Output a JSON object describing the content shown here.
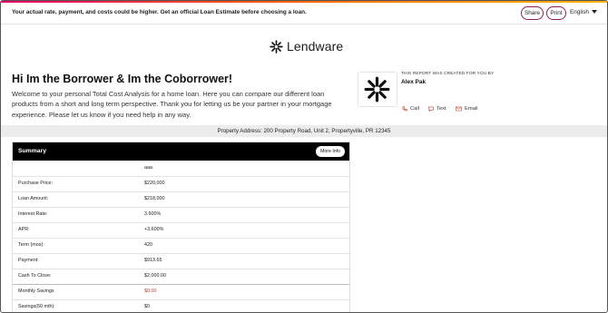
{
  "top_bar": {
    "notice": "Your actual rate, payment, and costs could be higher. Get an official Loan Estimate before choosing a loan.",
    "share_label": "Share",
    "print_label": "Print",
    "language": "English"
  },
  "brand": {
    "name": "Lendware"
  },
  "greeting": {
    "title": "Hi Im the Borrower & Im the Coborrower!",
    "body": "Welcome to your personal Total Cost Analysis for a home loan. Here you can compare our different loan products from a short and long term perspective. Thank you for letting us be your partner in your mortgage experience. Please let us know if you need help in any way."
  },
  "agent": {
    "caption": "THIS REPORT WAS CREATED FOR YOU BY",
    "name": "Alex Pak",
    "call_label": "Call",
    "text_label": "Text",
    "email_label": "Email"
  },
  "property": {
    "address": "Property Address: 200 Property Road, Unit 2, Propertyville, PR 12345"
  },
  "summary": {
    "title": "Summary",
    "more_info_label": "More Info",
    "column_header": "aaa",
    "rows": [
      {
        "label": "Purchase Price:",
        "value": "$220,000"
      },
      {
        "label": "Loan Amount:",
        "value": "$218,000"
      },
      {
        "label": "Interest Rate:",
        "value": "3.600%"
      },
      {
        "label": "APR:",
        "value": "+3.600%"
      },
      {
        "label": "Term (mos):",
        "value": "420"
      },
      {
        "label": "Payment:",
        "value": "$913.65"
      },
      {
        "label": "Cash To Close:",
        "value": "$2,000.00"
      },
      {
        "label": "Monthly Savings",
        "value": "$0.00"
      },
      {
        "label": "Savings(60 mth):",
        "value": "$0"
      }
    ]
  },
  "colors": {
    "accent": "#8a1d5a",
    "savings_red": "#b83a2b",
    "header_black": "#000000"
  }
}
